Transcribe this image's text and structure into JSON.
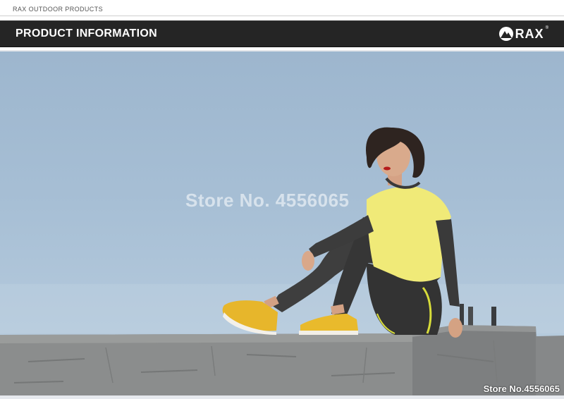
{
  "header": {
    "brand_line": "RAX OUTDOOR PRODUCTS",
    "section_title": "PRODUCT INFORMATION",
    "logo_text": "RAX",
    "logo_mark": "®"
  },
  "photo": {
    "watermark_center": "Store No. 4556065",
    "watermark_corner": "Store No.4556065",
    "icons": {
      "logo": "mountain-logo-icon"
    }
  },
  "colors": {
    "banner": "#252525",
    "sky": "#a7bfd5",
    "concrete": "#8a8c8c",
    "shirt": "#f2ec7a",
    "shoe": "#e8b92a",
    "leggings": "#3a3a3a"
  }
}
